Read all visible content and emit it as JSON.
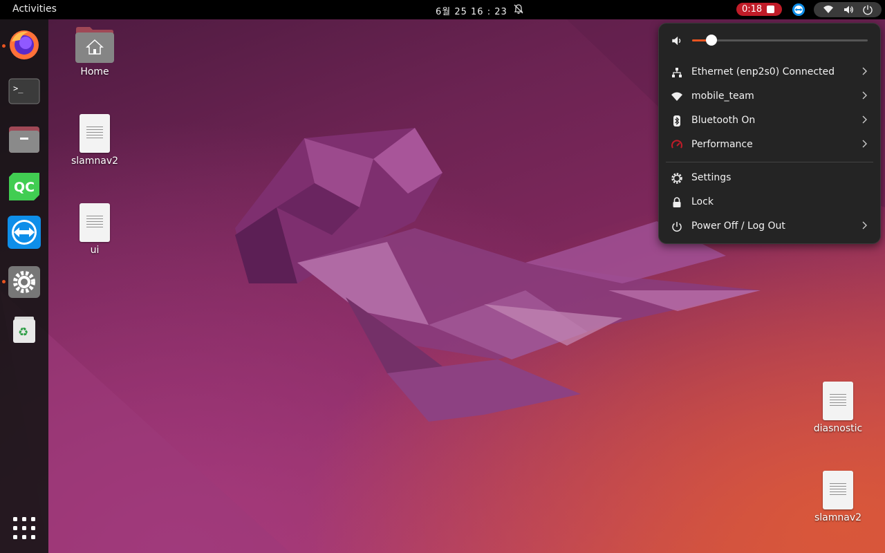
{
  "topbar": {
    "activities": "Activities",
    "clock": "6월 25  16 : 23",
    "recording_time": "0:18"
  },
  "dock": {
    "items": [
      "firefox",
      "terminal",
      "files",
      "qt-creator",
      "teamviewer",
      "settings",
      "trash",
      "show-applications"
    ]
  },
  "desktop": {
    "icons": [
      "Home",
      "slamnav2",
      "ui",
      "diasnostic",
      "slamnav2"
    ]
  },
  "quick_settings": {
    "volume_level": 0.11,
    "items": [
      {
        "label": "Ethernet (enp2s0) Connected",
        "icon": "network-wired-icon"
      },
      {
        "label": "mobile_team",
        "icon": "wifi-icon"
      },
      {
        "label": "Bluetooth On",
        "icon": "bluetooth-icon"
      },
      {
        "label": "Performance",
        "icon": "performance-icon"
      },
      {
        "label": "Settings",
        "icon": "gear-icon"
      },
      {
        "label": "Lock",
        "icon": "lock-icon"
      },
      {
        "label": "Power Off / Log Out",
        "icon": "power-icon"
      }
    ]
  },
  "colors": {
    "accent": "#e95420",
    "record": "#c01c28",
    "panel_bg": "#242424",
    "performance_icon": "#c01c28"
  }
}
